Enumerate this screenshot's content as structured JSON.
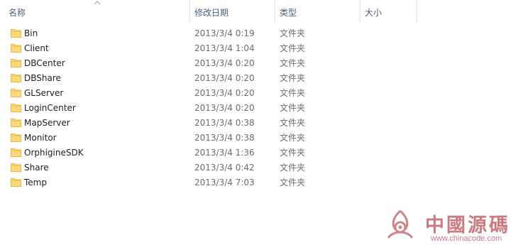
{
  "columns": {
    "name": "名称",
    "date": "修改日期",
    "type": "类型",
    "size": "大小"
  },
  "files": [
    {
      "name": "Bin",
      "date": "2013/3/4 0:19",
      "type": "文件夹"
    },
    {
      "name": "Client",
      "date": "2013/3/4 1:04",
      "type": "文件夹"
    },
    {
      "name": "DBCenter",
      "date": "2013/3/4 0:20",
      "type": "文件夹"
    },
    {
      "name": "DBShare",
      "date": "2013/3/4 0:20",
      "type": "文件夹"
    },
    {
      "name": "GLServer",
      "date": "2013/3/4 0:20",
      "type": "文件夹"
    },
    {
      "name": "LoginCenter",
      "date": "2013/3/4 0:20",
      "type": "文件夹"
    },
    {
      "name": "MapServer",
      "date": "2013/3/4 0:38",
      "type": "文件夹"
    },
    {
      "name": "Monitor",
      "date": "2013/3/4 0:38",
      "type": "文件夹"
    },
    {
      "name": "OrphigineSDK",
      "date": "2013/3/4 1:36",
      "type": "文件夹"
    },
    {
      "name": "Share",
      "date": "2013/3/4 0:42",
      "type": "文件夹"
    },
    {
      "name": "Temp",
      "date": "2013/3/4 7:03",
      "type": "文件夹"
    }
  ],
  "icons": {
    "folder": "folder-icon",
    "sort": "sort-ascending-icon"
  },
  "colors": {
    "header_text": "#4c607a",
    "folder_body": "#ffd97a",
    "folder_tab": "#e8b64a",
    "watermark": "#cc7a80"
  },
  "watermark": {
    "title": "中國源碼",
    "url": "www.chinacode.com"
  }
}
